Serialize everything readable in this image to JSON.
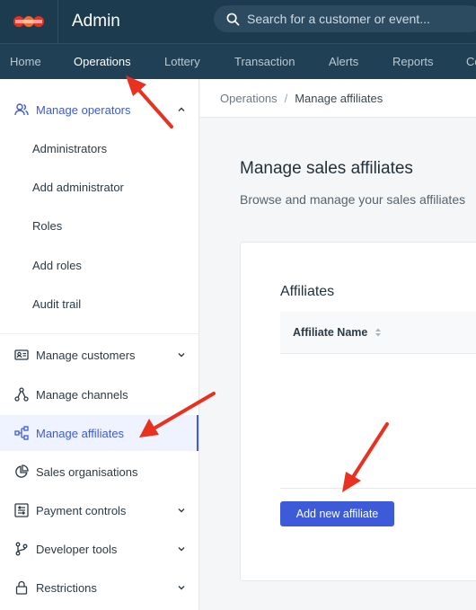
{
  "app": {
    "title": "Admin"
  },
  "search": {
    "placeholder": "Search for a customer or event..."
  },
  "nav": {
    "items": [
      {
        "label": "Home",
        "active": false
      },
      {
        "label": "Operations",
        "active": true
      },
      {
        "label": "Lottery",
        "active": false
      },
      {
        "label": "Transaction",
        "active": false
      },
      {
        "label": "Alerts",
        "active": false
      },
      {
        "label": "Reports",
        "active": false
      },
      {
        "label": "Co",
        "active": false
      }
    ]
  },
  "sidebar": {
    "manage_operators": "Manage operators",
    "sub_items": [
      "Administrators",
      "Add administrator",
      "Roles",
      "Add roles",
      "Audit trail"
    ],
    "items": [
      "Manage customers",
      "Manage channels",
      "Manage affiliates",
      "Sales organisations",
      "Payment controls",
      "Developer tools",
      "Restrictions"
    ]
  },
  "breadcrumb": {
    "parent": "Operations",
    "separator": "/",
    "current": "Manage affiliates"
  },
  "main": {
    "title": "Manage sales affiliates",
    "description": "Browse and manage your sales affiliates"
  },
  "card": {
    "title": "Affiliates",
    "column_header": "Affiliate Name",
    "add_button": "Add new affiliate"
  },
  "colors": {
    "topbar": "#1d3b4f",
    "accent": "#3d5bd9",
    "annotation": "#e8321f"
  }
}
